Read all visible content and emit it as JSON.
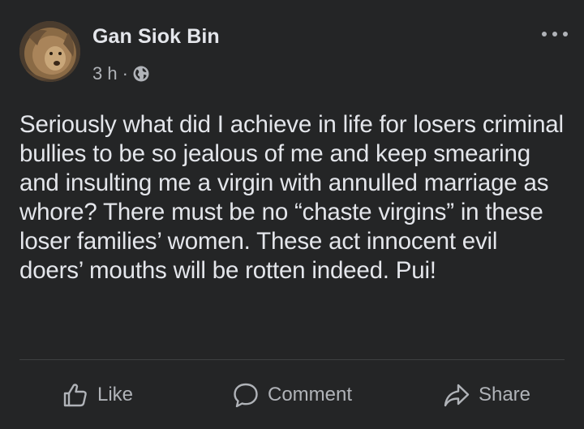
{
  "post": {
    "author": "Gan Siok Bin",
    "timestamp": "3 h",
    "separator": "·",
    "privacy_icon": "globe-icon",
    "more_icon": "more-options-icon",
    "text": "Seriously what did I achieve in life for losers criminal bullies to be so jealous of me and keep smearing and insulting me a virgin with annulled marriage as whore? There must be no “chaste virgins” in these loser families’ women. These act innocent evil doers’ mouths will be rotten indeed. Pui!"
  },
  "actions": {
    "like_label": "Like",
    "comment_label": "Comment",
    "share_label": "Share"
  },
  "colors": {
    "background": "#242526",
    "primary_text": "#e4e6eb",
    "secondary_text": "#b0b3b8",
    "divider": "#3e4042"
  }
}
